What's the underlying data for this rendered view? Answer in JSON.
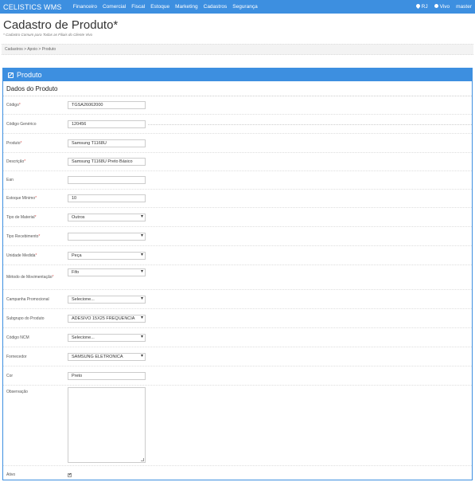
{
  "navbar": {
    "brand": "CELISTICS WMS",
    "items": [
      "Financeiro",
      "Comercial",
      "Fiscal",
      "Estoque",
      "Marketing",
      "Cadastros",
      "Segurança"
    ],
    "location": "RJ",
    "company": "Vivo",
    "user": "master",
    "colors": {
      "primary": "#3d8fe0"
    }
  },
  "page": {
    "title": "Cadastro de Produto*",
    "subtitle": "* Cadastro Comum para Todas as Filiais do Cliente Vivo",
    "breadcrumb": "Cadastros > Apoio > Produto"
  },
  "panel": {
    "title": "Produto",
    "section": "Dados do Produto"
  },
  "form": {
    "codigo": {
      "label": "Código",
      "required": "*",
      "value": "TGSA26062000"
    },
    "codigo_generico": {
      "label": "Código Genérico",
      "value": "120456"
    },
    "produto": {
      "label": "Produto",
      "required": "*",
      "value": "Samsung T1168U"
    },
    "descricao": {
      "label": "Descrição",
      "required": "*",
      "value": "Samsung T1168U Preto Básico"
    },
    "ean": {
      "label": "Ean",
      "value": ""
    },
    "estoque_minimo": {
      "label": "Estoque Mínimo",
      "required": "*",
      "value": "10"
    },
    "tipo_material": {
      "label": "Tipo de Material",
      "required": "*",
      "value": "Outros"
    },
    "tipo_recebimento": {
      "label": "Tipo Recebimento",
      "required": "*",
      "value": ""
    },
    "unidade_medida": {
      "label": "Unidade Medida",
      "required": "*",
      "value": "Peça"
    },
    "metodo_movimentacao": {
      "label": "Método de Movimentação",
      "required": "*",
      "value": "Fifo"
    },
    "campanha": {
      "label": "Campanha Promocional",
      "value": "Selecione..."
    },
    "subgrupo": {
      "label": "Subgrupo do Produto",
      "value": "ADESIVO 15X25 FREQUENCIA"
    },
    "ncm": {
      "label": "Código NCM",
      "value": "Selecione..."
    },
    "fornecedor": {
      "label": "Fornecedor",
      "value": "SAMSUNG ELETRONICA"
    },
    "cor": {
      "label": "Cor",
      "value": "Preto"
    },
    "observacao": {
      "label": "Observação",
      "value": ""
    },
    "ativo": {
      "label": "Ativo",
      "checked": "✔"
    }
  },
  "icons": [
    "map-marker-icon",
    "user-icon",
    "edit-icon",
    "caret-down-icon"
  ]
}
